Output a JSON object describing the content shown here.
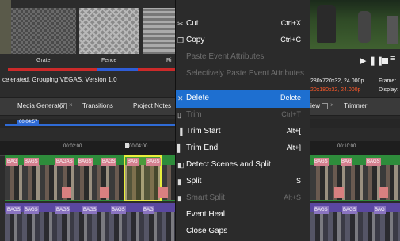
{
  "effects": {
    "thumbs": [
      {
        "label": "Grate"
      },
      {
        "label": "Fence"
      },
      {
        "label": "Ri"
      }
    ]
  },
  "status": {
    "left_text": "celerated, Grouping VEGAS, Version 1.0",
    "video_info_1": "280x720x32, 24.000p",
    "video_info_2": "20x180x32, 24.000p",
    "frame_label": "Frame:",
    "display_label": "Display:"
  },
  "tabs": {
    "media_generator": "Media Generator",
    "transitions": "Transitions",
    "project_notes": "Project Notes",
    "view": "iew",
    "trimmer": "Trimmer"
  },
  "timeline": {
    "cursor_time": "00:04:57",
    "ruler_marks": [
      "00:02:00",
      "00:04:00",
      "00:10:00"
    ]
  },
  "clip_tags": [
    "BAG",
    "BAGS",
    "BAGAS",
    "BAGS",
    "BAGS",
    "BAG",
    "BAGS",
    "BAGS",
    "BAG"
  ],
  "context_menu": {
    "items": [
      {
        "label": "Cut",
        "shortcut": "Ctrl+X",
        "icon": "scissors-icon",
        "enabled": true
      },
      {
        "label": "Copy",
        "shortcut": "Ctrl+C",
        "icon": "copy-icon",
        "enabled": true
      },
      {
        "label": "Paste Event Attributes",
        "shortcut": "",
        "icon": "",
        "enabled": false
      },
      {
        "label": "Selectively Paste Event Attributes",
        "shortcut": "",
        "icon": "",
        "enabled": false
      },
      {
        "label": "Delete",
        "shortcut": "Delete",
        "icon": "delete-x-icon",
        "enabled": true,
        "highlighted": true
      },
      {
        "label": "Trim",
        "shortcut": "Ctrl+T",
        "icon": "trim-icon",
        "enabled": false
      },
      {
        "label": "Trim Start",
        "shortcut": "Alt+[",
        "icon": "trim-start-icon",
        "enabled": true
      },
      {
        "label": "Trim End",
        "shortcut": "Alt+]",
        "icon": "trim-end-icon",
        "enabled": true
      },
      {
        "label": "Detect Scenes and Split",
        "shortcut": "",
        "icon": "detect-scenes-icon",
        "enabled": true
      },
      {
        "label": "Split",
        "shortcut": "S",
        "icon": "split-icon",
        "enabled": true
      },
      {
        "label": "Smart Split",
        "shortcut": "Alt+S",
        "icon": "smart-split-icon",
        "enabled": false
      },
      {
        "label": "Event Heal",
        "shortcut": "",
        "icon": "",
        "enabled": true
      },
      {
        "label": "Close Gaps",
        "shortcut": "",
        "icon": "",
        "enabled": true
      }
    ]
  },
  "colors": {
    "menu_bg": "#2b2b2b",
    "menu_highlight": "#1e6fd0",
    "tag_pink": "#d4808f",
    "tag_purple": "#8a74c0",
    "track_green": "#2e8c3b",
    "video_blue": "#2f5dd6",
    "status_red": "#cc2a2a"
  }
}
